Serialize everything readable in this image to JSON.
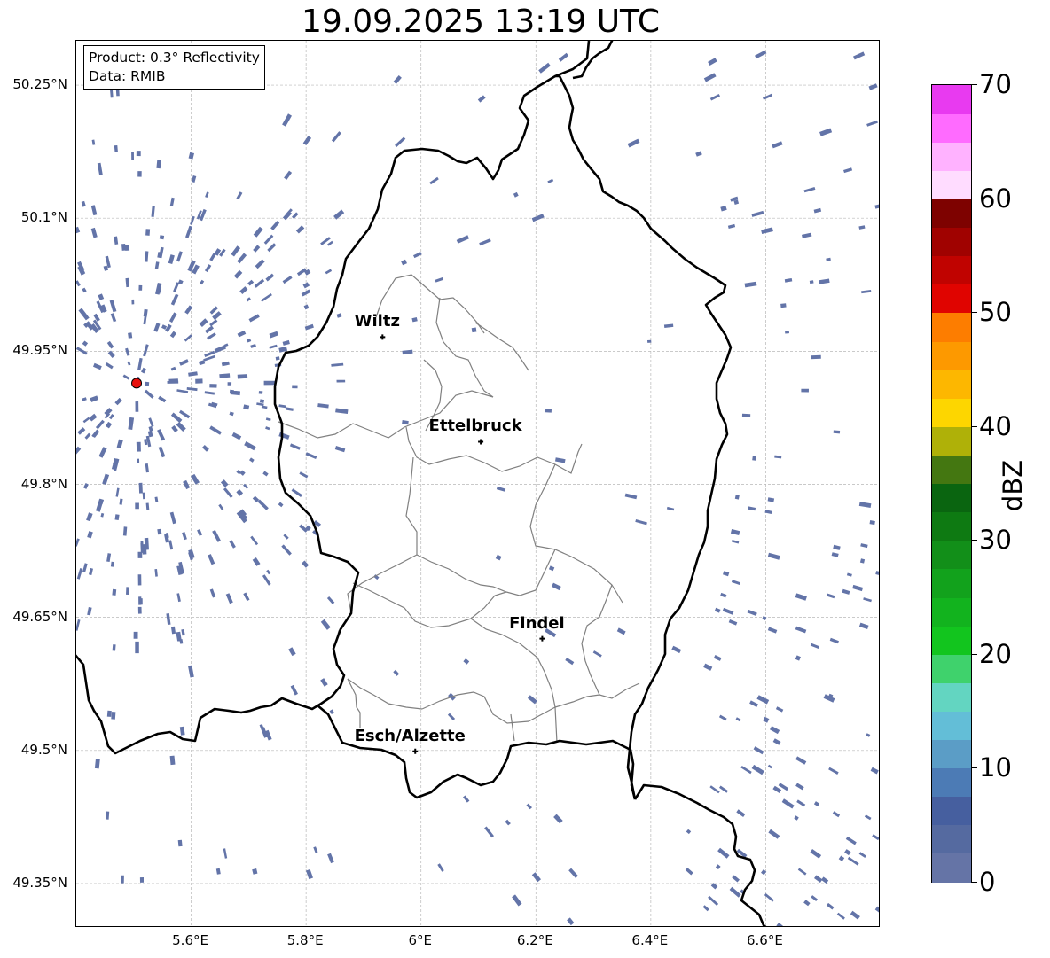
{
  "title": "19.09.2025 13:19 UTC",
  "infobox": {
    "product": "Product: 0.3° Reflectivity",
    "data": "Data: RMIB"
  },
  "map": {
    "lon_range": [
      5.4,
      6.8
    ],
    "lat_range": [
      49.3,
      50.3
    ],
    "lat_ticks": [
      {
        "value": 50.25,
        "label": "50.25°N"
      },
      {
        "value": 50.1,
        "label": "50.1°N"
      },
      {
        "value": 49.95,
        "label": "49.95°N"
      },
      {
        "value": 49.8,
        "label": "49.8°N"
      },
      {
        "value": 49.65,
        "label": "49.65°N"
      },
      {
        "value": 49.5,
        "label": "49.5°N"
      },
      {
        "value": 49.35,
        "label": "49.35°N"
      }
    ],
    "lon_ticks": [
      {
        "value": 5.6,
        "label": "5.6°E"
      },
      {
        "value": 5.8,
        "label": "5.8°E"
      },
      {
        "value": 6.0,
        "label": "6°E"
      },
      {
        "value": 6.2,
        "label": "6.2°E"
      },
      {
        "value": 6.4,
        "label": "6.4°E"
      },
      {
        "value": 6.6,
        "label": "6.6°E"
      }
    ],
    "gridlines": true,
    "radar_site": {
      "lon": 5.505,
      "lat": 49.914,
      "color": "#e8100c"
    },
    "cities": [
      {
        "name": "Wiltz",
        "lon": 5.933,
        "lat": 49.966
      },
      {
        "name": "Ettelbruck",
        "lon": 6.104,
        "lat": 49.848
      },
      {
        "name": "Findel",
        "lon": 6.211,
        "lat": 49.626
      },
      {
        "name": "Esch/Alzette",
        "lon": 5.99,
        "lat": 49.499
      }
    ],
    "echo_color": "#6374a8",
    "border_color": "#000000",
    "canton_color": "#808080"
  },
  "colorbar": {
    "label": "dBZ",
    "min": 0,
    "max": 70,
    "ticks": [
      {
        "value": 0,
        "label": "0"
      },
      {
        "value": 10,
        "label": "10"
      },
      {
        "value": 20,
        "label": "20"
      },
      {
        "value": 30,
        "label": "30"
      },
      {
        "value": 40,
        "label": "40"
      },
      {
        "value": 50,
        "label": "50"
      },
      {
        "value": 60,
        "label": "60"
      },
      {
        "value": 70,
        "label": "70"
      }
    ],
    "colors": [
      "#6574a6",
      "#556aa0",
      "#465f9f",
      "#4c7bb5",
      "#5b9dc6",
      "#63bed7",
      "#63d5c1",
      "#3fd26c",
      "#12c51e",
      "#12b31e",
      "#12a21c",
      "#128f19",
      "#0e7a12",
      "#0a6510",
      "#447711",
      "#afb108",
      "#fdd600",
      "#fdb700",
      "#fd9900",
      "#fd7d00",
      "#e00400",
      "#c00300",
      "#a00200",
      "#7e0200",
      "#ffdcff",
      "#ffb2ff",
      "#ff6bff",
      "#e83af0"
    ]
  }
}
